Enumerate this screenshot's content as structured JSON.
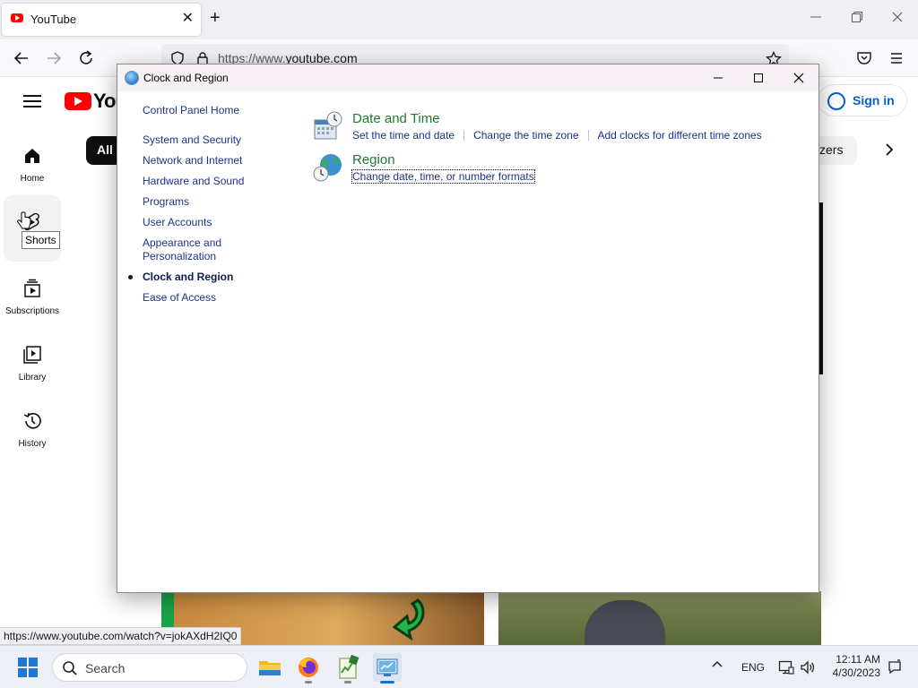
{
  "browser": {
    "tab_title": "YouTube",
    "tab_close": "✕",
    "new_tab": "+",
    "url_prefix": "https://www.",
    "url_domain": "youtube.com",
    "status_url": "https://www.youtube.com/watch?v=jokAXdH2IQ0",
    "icons": [
      "youtube-favicon",
      "back-arrow-icon",
      "forward-arrow-icon",
      "reload-icon",
      "shield-icon",
      "lock-icon",
      "bookmark-star-icon",
      "pocket-icon",
      "menu-icon",
      "minimize-icon",
      "restore-icon",
      "close-icon"
    ]
  },
  "youtube": {
    "logo_text": "You",
    "sign_in": "Sign in",
    "chip_all": "All",
    "chip_partial": "zers",
    "sidebar": [
      {
        "label": "Home",
        "icon": "home-icon"
      },
      {
        "label": "Shorts",
        "icon": "shorts-icon"
      },
      {
        "label": "Subscriptions",
        "icon": "subscriptions-icon"
      },
      {
        "label": "Library",
        "icon": "library-icon"
      },
      {
        "label": "History",
        "icon": "history-icon"
      }
    ],
    "tooltip": "Shorts"
  },
  "control_panel": {
    "window_title": "Clock and Region",
    "nav": {
      "home": "Control Panel Home",
      "items": [
        "System and Security",
        "Network and Internet",
        "Hardware and Sound",
        "Programs",
        "User Accounts",
        "Appearance and Personalization",
        "Clock and Region",
        "Ease of Access"
      ],
      "current": "Clock and Region"
    },
    "categories": [
      {
        "title": "Date and Time",
        "icon": "date-time-icon",
        "links": [
          "Set the time and date",
          "Change the time zone",
          "Add clocks for different time zones"
        ]
      },
      {
        "title": "Region",
        "icon": "region-globe-icon",
        "links": [
          "Change date, time, or number formats"
        ]
      }
    ]
  },
  "taskbar": {
    "search_placeholder": "Search",
    "apps": [
      "file-explorer-icon",
      "firefox-icon",
      "task-manager-icon",
      "control-panel-icon"
    ],
    "tray_language": "ENG",
    "time": "12:11 AM",
    "date": "4/30/2023",
    "accent": "#1c6fd1"
  }
}
